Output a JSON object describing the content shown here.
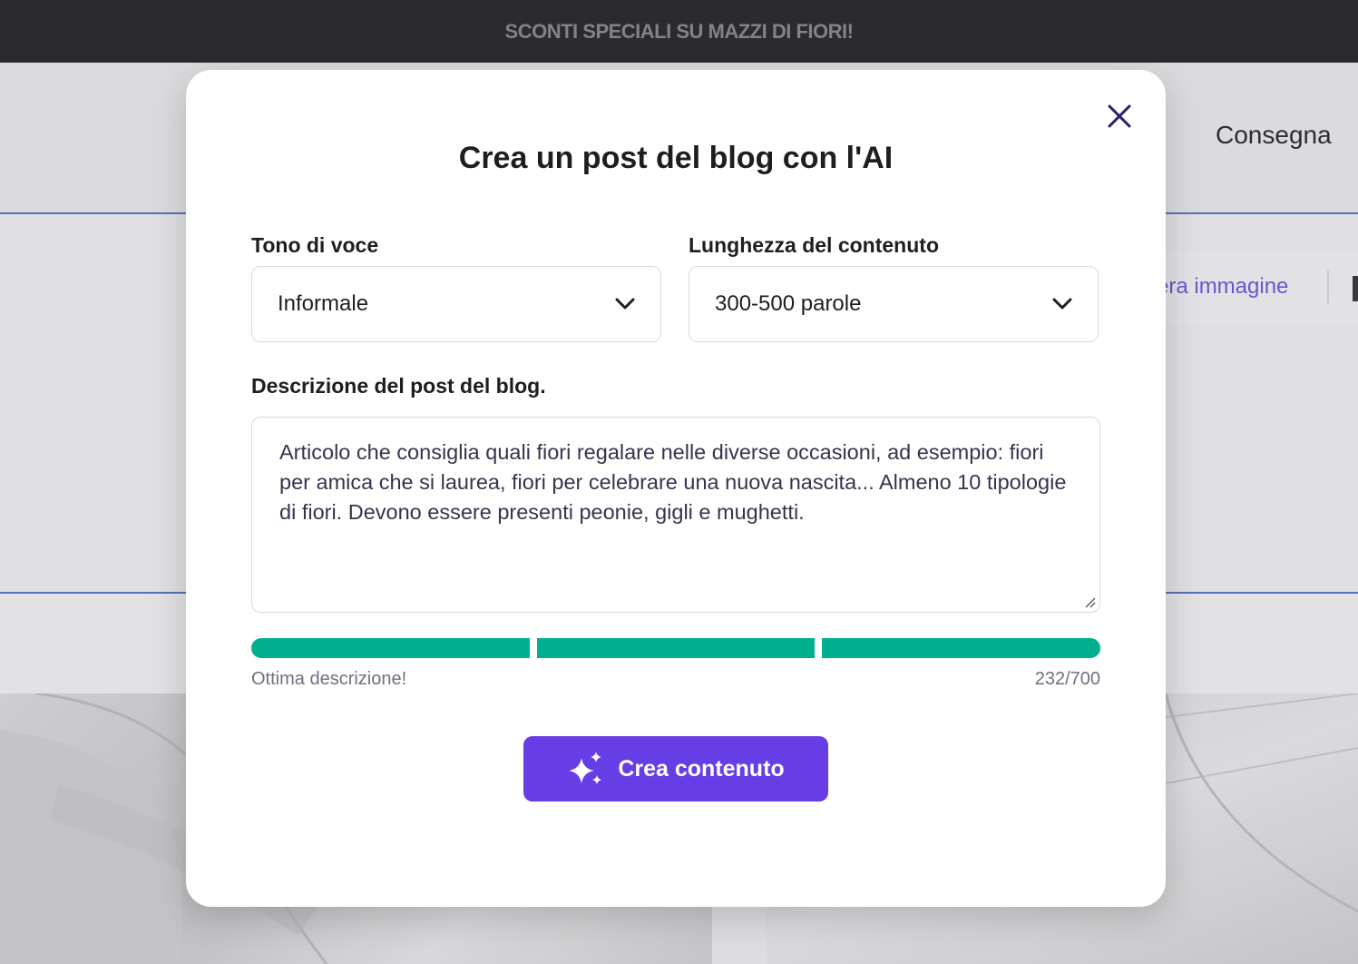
{
  "promo": {
    "text": "SCONTI SPECIALI SU MAZZI DI FIORI!"
  },
  "background": {
    "nav_item": "Consegna",
    "toolbar_link": "era immagine"
  },
  "modal": {
    "title": "Crea un post del blog con l'AI",
    "tone": {
      "label": "Tono di voce",
      "value": "Informale",
      "icon": "chevron-down-icon"
    },
    "length": {
      "label": "Lunghezza del contenuto",
      "value": "300-500 parole",
      "icon": "chevron-down-icon"
    },
    "description": {
      "label": "Descrizione del post del blog.",
      "value": "Articolo che consiglia quali fiori regalare nelle diverse occasioni, ad esempio: fiori per amica che si laurea, fiori per celebrare una nuova nascita... Almeno 10 tipologie di fiori. Devono essere presenti peonie, gigli e mughetti."
    },
    "quality": {
      "segments_filled": 3,
      "segments_total": 3,
      "color": "#00b090",
      "message": "Ottima descrizione!",
      "counter": "232/700"
    },
    "create_button": {
      "label": "Crea contenuto",
      "icon": "sparkles-icon",
      "color": "#673de6"
    },
    "close_icon": "close-icon"
  }
}
